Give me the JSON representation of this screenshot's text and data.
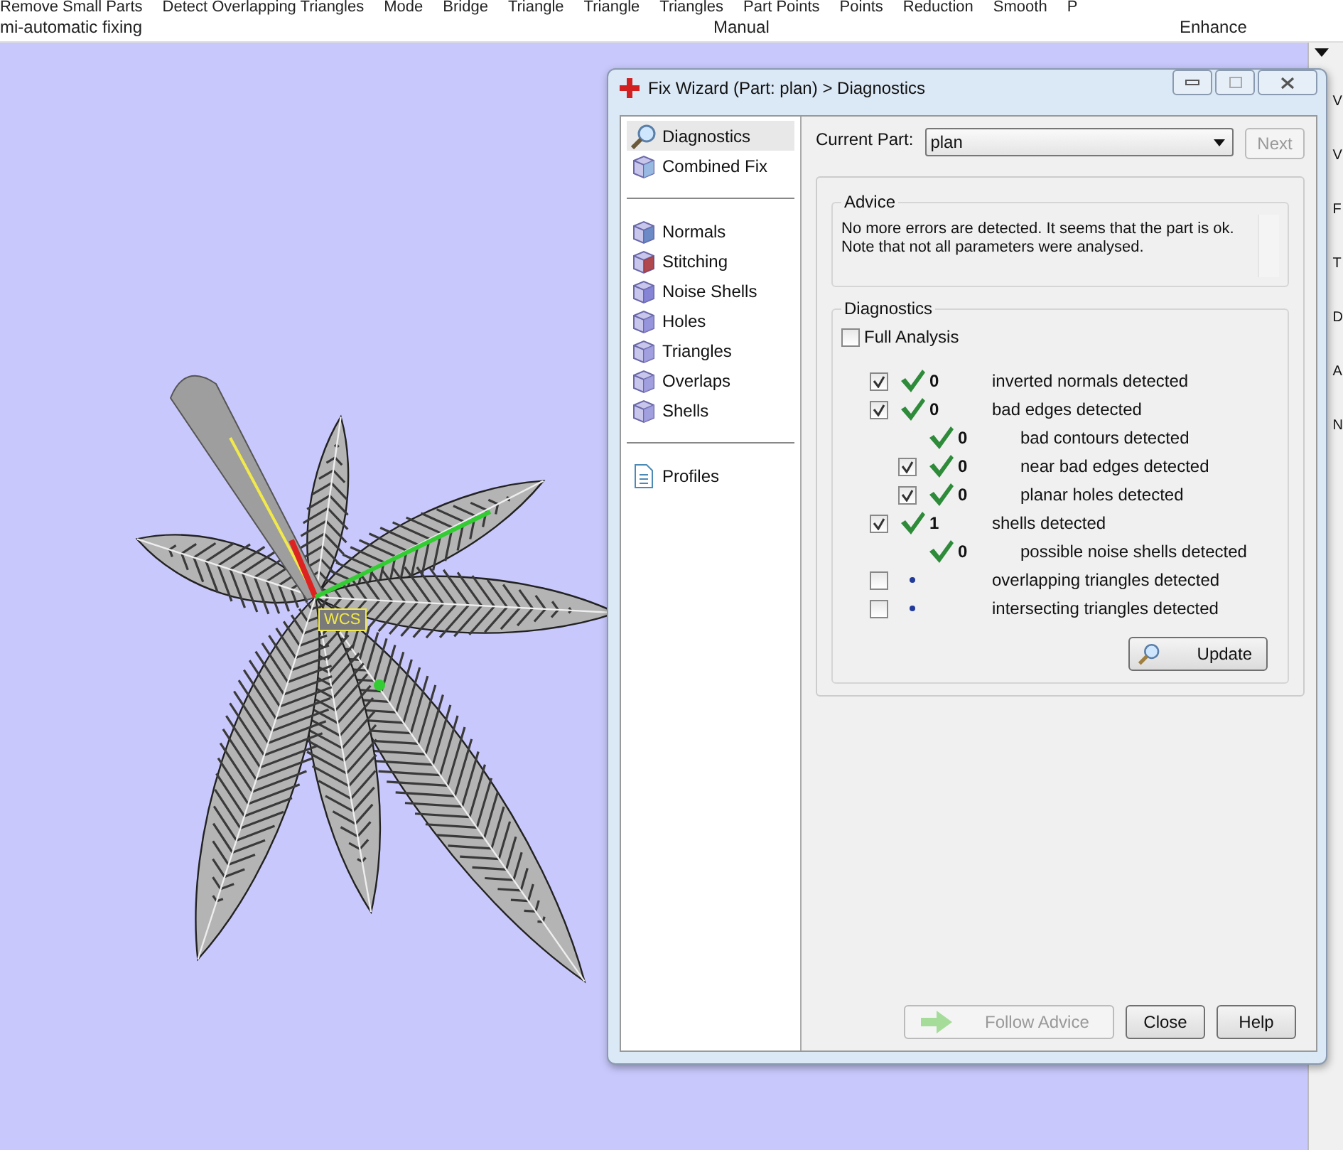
{
  "ribbon": {
    "tools": [
      "Remove Small Parts",
      "Detect Overlapping Triangles",
      "Mode",
      "Bridge",
      "Triangle",
      "Triangle",
      "Triangles",
      "Part Points",
      "Points",
      "Reduction",
      "Smooth",
      "P"
    ],
    "groups": [
      "mi-automatic fixing",
      "Manual",
      "Enhance"
    ]
  },
  "viewport": {
    "axis_label": "WCS"
  },
  "right_panel": {
    "letters": [
      "V",
      "V",
      "F",
      "T",
      "D",
      "A",
      "N"
    ]
  },
  "dialog": {
    "title": "Fix Wizard (Part: plan) > Diagnostics",
    "nav_groups": [
      [
        {
          "label": "Diagnostics",
          "selected": true
        },
        {
          "label": "Combined Fix",
          "selected": false
        }
      ],
      [
        {
          "label": "Normals",
          "selected": false
        },
        {
          "label": "Stitching",
          "selected": false
        },
        {
          "label": "Noise Shells",
          "selected": false
        },
        {
          "label": "Holes",
          "selected": false
        },
        {
          "label": "Triangles",
          "selected": false
        },
        {
          "label": "Overlaps",
          "selected": false
        },
        {
          "label": "Shells",
          "selected": false
        }
      ],
      [
        {
          "label": "Profiles",
          "selected": false
        }
      ]
    ],
    "current_part_label": "Current Part:",
    "current_part": "plan",
    "next_button": {
      "label": "Next",
      "disabled": true
    },
    "advice": {
      "title": "Advice",
      "text": "No more errors are detected. It seems that the part is ok.\nNote that not all parameters were analysed."
    },
    "diagnostics": {
      "title": "Diagnostics",
      "full_analysis": {
        "label": "Full Analysis",
        "checked": false
      },
      "rows": [
        {
          "label": "inverted normals detected",
          "count": "0",
          "passed": true,
          "checked": true
        },
        {
          "label": "bad edges detected",
          "count": "0",
          "passed": true,
          "checked": true,
          "children": [
            {
              "label": "bad contours detected",
              "count": "0",
              "passed": true
            },
            {
              "label": "near bad edges detected",
              "count": "0",
              "passed": true,
              "checked": true
            },
            {
              "label": "planar holes detected",
              "count": "0",
              "passed": true,
              "checked": true
            }
          ]
        },
        {
          "label": "shells detected",
          "count": "1",
          "passed": true,
          "checked": true,
          "children": [
            {
              "label": "possible noise shells detected",
              "count": "0",
              "passed": true
            }
          ]
        },
        {
          "label": "overlapping triangles detected",
          "passed": false,
          "checked": false
        },
        {
          "label": "intersecting triangles detected",
          "passed": false,
          "checked": false
        }
      ],
      "update_button": "Update"
    },
    "buttons": [
      {
        "label": "Follow Advice",
        "disabled": true
      },
      {
        "label": "Close",
        "disabled": false
      },
      {
        "label": "Help",
        "disabled": false
      }
    ]
  }
}
